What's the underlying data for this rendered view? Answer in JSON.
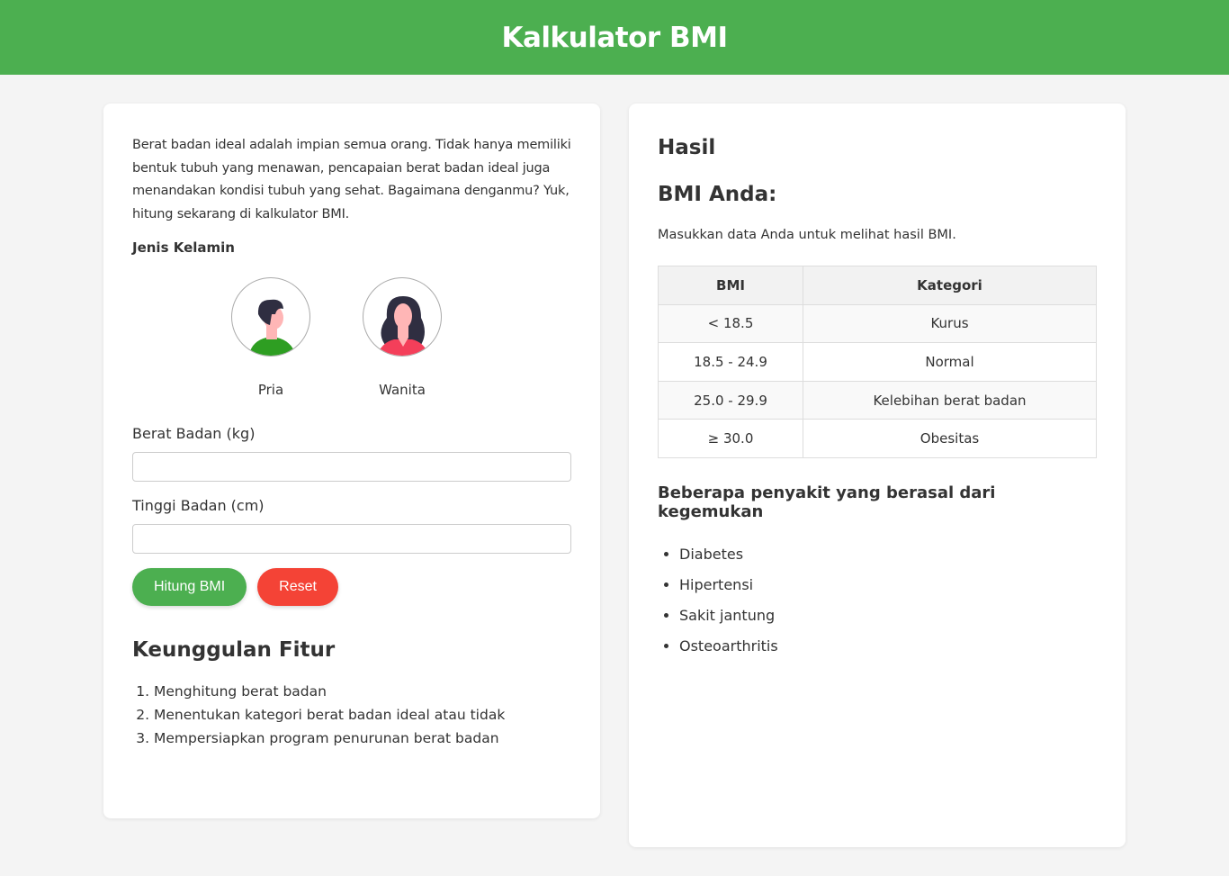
{
  "header": {
    "title": "Kalkulator BMI"
  },
  "form": {
    "intro": "Berat badan ideal adalah impian semua orang. Tidak hanya memiliki bentuk tubuh yang menawan, pencapaian berat badan ideal juga menandakan kondisi tubuh yang sehat. Bagaimana denganmu? Yuk, hitung sekarang di kalkulator BMI.",
    "gender_label": "Jenis Kelamin",
    "genders": [
      {
        "label": "Pria",
        "icon": "male-avatar-icon"
      },
      {
        "label": "Wanita",
        "icon": "female-avatar-icon"
      }
    ],
    "weight_label": "Berat Badan (kg)",
    "weight_value": "",
    "height_label": "Tinggi Badan (cm)",
    "height_value": "",
    "calc_button": "Hitung BMI",
    "reset_button": "Reset"
  },
  "features": {
    "title": "Keunggulan Fitur",
    "items": [
      "Menghitung berat badan",
      "Menentukan kategori berat badan ideal atau tidak",
      "Mempersiapkan program penurunan berat badan"
    ]
  },
  "result": {
    "title": "Hasil",
    "bmi_title": "BMI Anda:",
    "message": "Masukkan data Anda untuk melihat hasil BMI.",
    "table": {
      "headers": [
        "BMI",
        "Kategori"
      ],
      "rows": [
        [
          "< 18.5",
          "Kurus"
        ],
        [
          "18.5 - 24.9",
          "Normal"
        ],
        [
          "25.0 - 29.9",
          "Kelebihan berat badan"
        ],
        [
          "≥ 30.0",
          "Obesitas"
        ]
      ]
    },
    "diseases_title": "Beberapa penyakit yang berasal dari kegemukan",
    "diseases": [
      "Diabetes",
      "Hipertensi",
      "Sakit jantung",
      "Osteoarthritis"
    ]
  },
  "colors": {
    "primary": "#4caf50",
    "danger": "#f44336",
    "male_shirt": "#2e9e22",
    "female_shirt": "#f43f5a",
    "hair": "#2f2e41",
    "skin": "#ffb6b6"
  }
}
